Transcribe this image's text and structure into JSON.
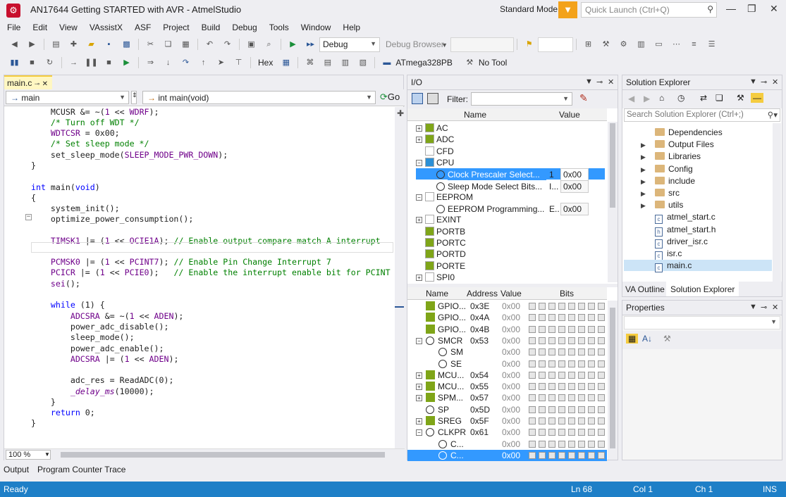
{
  "window": {
    "title": "AN17644 Getting STARTED with AVR - AtmelStudio",
    "mode": "Standard Mode",
    "quick_launch_placeholder": "Quick Launch (Ctrl+Q)"
  },
  "menu": [
    "File",
    "Edit",
    "View",
    "VAssistX",
    "ASF",
    "Project",
    "Build",
    "Debug",
    "Tools",
    "Window",
    "Help"
  ],
  "toolbar": {
    "config": "Debug",
    "debug_browser": "Debug Browser",
    "hex_label": "Hex",
    "device": "ATmega328PB",
    "tool": "No Tool"
  },
  "editor": {
    "tab": "main.c",
    "nav_left": "main",
    "nav_right": "int main(void)",
    "go_label": "Go",
    "zoom": "100 %"
  },
  "io": {
    "title": "I/O",
    "filter_label": "Filter:",
    "col_name": "Name",
    "col_value": "Value",
    "top_rows": [
      {
        "label": "AC",
        "indent": 0,
        "exp": "+"
      },
      {
        "label": "ADC",
        "indent": 0,
        "exp": "+"
      },
      {
        "label": "CFD",
        "indent": 0,
        "exp": ""
      },
      {
        "label": "CPU",
        "indent": 0,
        "exp": "-"
      },
      {
        "label": "Clock Prescaler Select...",
        "indent": 1,
        "value": "1",
        "value2": "0x00",
        "selected": true
      },
      {
        "label": "Sleep Mode Select Bits...",
        "indent": 1,
        "value": "I...",
        "value2": "0x00"
      },
      {
        "label": "EEPROM",
        "indent": 0,
        "exp": "-"
      },
      {
        "label": "EEPROM Programming...",
        "indent": 1,
        "value": "E..",
        "value2": "0x00"
      },
      {
        "label": "EXINT",
        "indent": 0,
        "exp": "+"
      },
      {
        "label": "PORTB",
        "indent": 0,
        "exp": ""
      },
      {
        "label": "PORTC",
        "indent": 0,
        "exp": ""
      },
      {
        "label": "PORTD",
        "indent": 0,
        "exp": ""
      },
      {
        "label": "PORTE",
        "indent": 0,
        "exp": ""
      },
      {
        "label": "SPI0",
        "indent": 0,
        "exp": "+"
      }
    ],
    "bottom_headers": {
      "name": "Name",
      "address": "Address",
      "value": "Value",
      "bits": "Bits"
    },
    "bottom_rows": [
      {
        "name": "GPIO...",
        "addr": "0x3E",
        "val": "0x00"
      },
      {
        "name": "GPIO...",
        "addr": "0x4A",
        "val": "0x00"
      },
      {
        "name": "GPIO...",
        "addr": "0x4B",
        "val": "0x00"
      },
      {
        "name": "SMCR",
        "addr": "0x53",
        "val": "0x00"
      },
      {
        "name": "SM",
        "addr": "",
        "val": "0x00"
      },
      {
        "name": "SE",
        "addr": "",
        "val": "0x00"
      },
      {
        "name": "MCU...",
        "addr": "0x54",
        "val": "0x00"
      },
      {
        "name": "MCU...",
        "addr": "0x55",
        "val": "0x00"
      },
      {
        "name": "SPM...",
        "addr": "0x57",
        "val": "0x00"
      },
      {
        "name": "SP",
        "addr": "0x5D",
        "val": "0x00"
      },
      {
        "name": "SREG",
        "addr": "0x5F",
        "val": "0x00"
      },
      {
        "name": "CLKPR",
        "addr": "0x61",
        "val": "0x00"
      },
      {
        "name": "C...",
        "addr": "",
        "val": "0x00"
      },
      {
        "name": "C...",
        "addr": "",
        "val": "0x00"
      }
    ]
  },
  "solution": {
    "title": "Solution Explorer",
    "search_placeholder": "Search Solution Explorer (Ctrl+;)",
    "items": [
      {
        "label": "Dependencies",
        "type": "folder"
      },
      {
        "label": "Output Files",
        "type": "folder"
      },
      {
        "label": "Libraries",
        "type": "folder"
      },
      {
        "label": "Config",
        "type": "folder"
      },
      {
        "label": "include",
        "type": "folder"
      },
      {
        "label": "src",
        "type": "folder"
      },
      {
        "label": "utils",
        "type": "folder"
      },
      {
        "label": "atmel_start.c",
        "type": "c"
      },
      {
        "label": "atmel_start.h",
        "type": "h"
      },
      {
        "label": "driver_isr.c",
        "type": "c"
      },
      {
        "label": "isr.c",
        "type": "c"
      },
      {
        "label": "main.c",
        "type": "c"
      }
    ],
    "tab1": "VA Outline",
    "tab2": "Solution Explorer"
  },
  "properties": {
    "title": "Properties"
  },
  "bottom_tabs": [
    "Output",
    "Program Counter Trace"
  ],
  "status": {
    "ready": "Ready",
    "ln": "Ln 68",
    "col": "Col 1",
    "ch": "Ch 1",
    "ins": "INS"
  }
}
